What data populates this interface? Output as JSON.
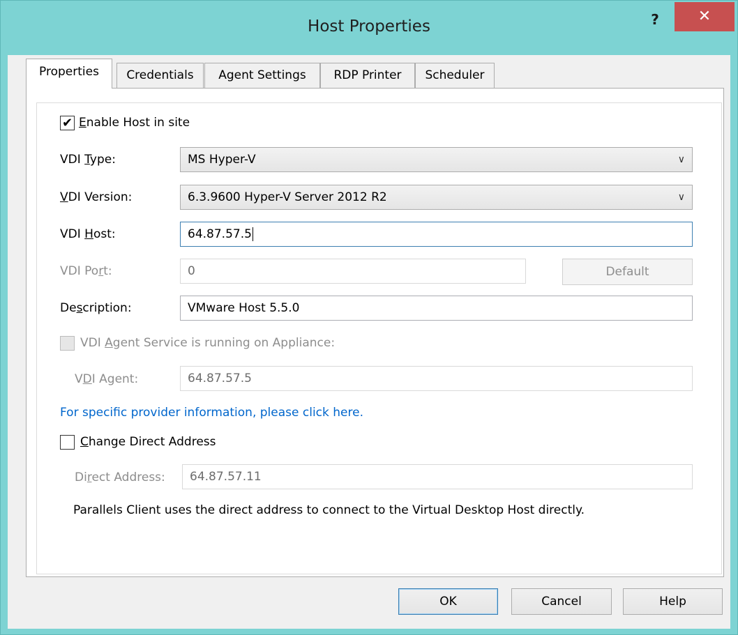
{
  "window": {
    "title": "Host Properties",
    "help_glyph": "?",
    "close_glyph": "✕"
  },
  "tabs": [
    {
      "label": "Properties",
      "active": true
    },
    {
      "label": "Credentials",
      "active": false
    },
    {
      "label": "Agent Settings",
      "active": false
    },
    {
      "label": "RDP Printer",
      "active": false
    },
    {
      "label": "Scheduler",
      "active": false
    }
  ],
  "form": {
    "enable_host": {
      "label_prefix": "",
      "label_mnemonic": "E",
      "label_rest": "nable Host in site",
      "checked": true
    },
    "vdi_type": {
      "label_a": "VDI ",
      "label_m": "T",
      "label_b": "ype:",
      "value": "MS Hyper-V"
    },
    "vdi_version": {
      "label_a": "",
      "label_m": "V",
      "label_b": "DI Version:",
      "value": "6.3.9600 Hyper-V Server 2012 R2"
    },
    "vdi_host": {
      "label_a": "VDI ",
      "label_m": "H",
      "label_b": "ost:",
      "value": "64.87.57.5"
    },
    "vdi_port": {
      "label_a": "VDI Po",
      "label_m": "r",
      "label_b": "t:",
      "value": "0",
      "default_button": "Default"
    },
    "description": {
      "label_a": "De",
      "label_m": "s",
      "label_b": "cription:",
      "value": "VMware Host 5.5.0"
    },
    "agent_service": {
      "label_a": "VDI ",
      "label_m": "A",
      "label_b": "gent Service is running on Appliance:",
      "checked": false
    },
    "vdi_agent": {
      "label_a": "V",
      "label_m": "D",
      "label_b": "I Agent:",
      "value": "64.87.57.5"
    },
    "provider_link": "For specific provider information, please click here.",
    "change_direct": {
      "label_a": "",
      "label_m": "C",
      "label_b": "hange Direct Address",
      "checked": false
    },
    "direct_address": {
      "label_a": "Di",
      "label_m": "r",
      "label_b": "ect Address:",
      "value": "64.87.57.11"
    },
    "direct_note": "Parallels Client uses the direct address to connect to the Virtual Desktop Host directly."
  },
  "buttons": {
    "ok": "OK",
    "cancel": "Cancel",
    "help": "Help"
  },
  "icons": {
    "checkmark": "✔",
    "dropdown": "chevron-down-icon"
  },
  "colors": {
    "titlebar": "#7dd3d3",
    "close": "#c75050",
    "link": "#0066cc"
  }
}
